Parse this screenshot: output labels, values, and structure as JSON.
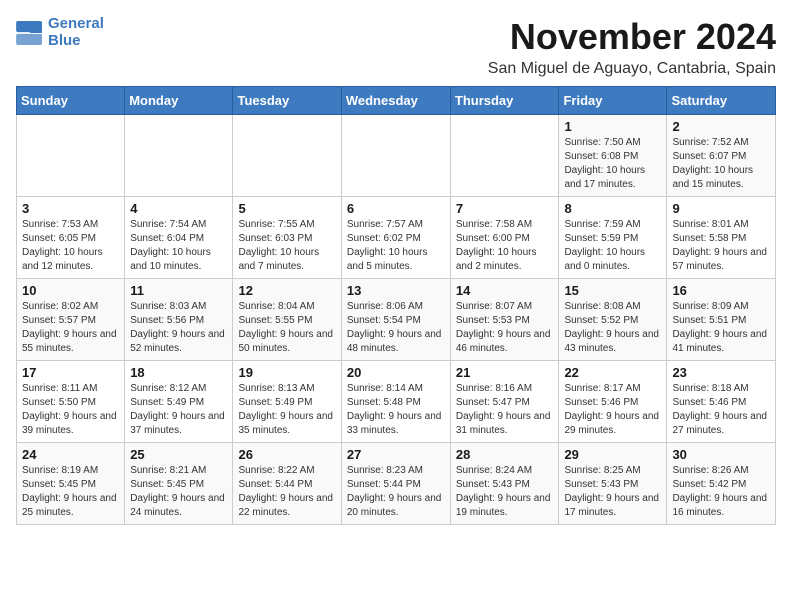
{
  "logo": {
    "line1": "General",
    "line2": "Blue"
  },
  "title": "November 2024",
  "location": "San Miguel de Aguayo, Cantabria, Spain",
  "headers": [
    "Sunday",
    "Monday",
    "Tuesday",
    "Wednesday",
    "Thursday",
    "Friday",
    "Saturday"
  ],
  "weeks": [
    [
      {
        "day": "",
        "info": ""
      },
      {
        "day": "",
        "info": ""
      },
      {
        "day": "",
        "info": ""
      },
      {
        "day": "",
        "info": ""
      },
      {
        "day": "",
        "info": ""
      },
      {
        "day": "1",
        "info": "Sunrise: 7:50 AM\nSunset: 6:08 PM\nDaylight: 10 hours and 17 minutes."
      },
      {
        "day": "2",
        "info": "Sunrise: 7:52 AM\nSunset: 6:07 PM\nDaylight: 10 hours and 15 minutes."
      }
    ],
    [
      {
        "day": "3",
        "info": "Sunrise: 7:53 AM\nSunset: 6:05 PM\nDaylight: 10 hours and 12 minutes."
      },
      {
        "day": "4",
        "info": "Sunrise: 7:54 AM\nSunset: 6:04 PM\nDaylight: 10 hours and 10 minutes."
      },
      {
        "day": "5",
        "info": "Sunrise: 7:55 AM\nSunset: 6:03 PM\nDaylight: 10 hours and 7 minutes."
      },
      {
        "day": "6",
        "info": "Sunrise: 7:57 AM\nSunset: 6:02 PM\nDaylight: 10 hours and 5 minutes."
      },
      {
        "day": "7",
        "info": "Sunrise: 7:58 AM\nSunset: 6:00 PM\nDaylight: 10 hours and 2 minutes."
      },
      {
        "day": "8",
        "info": "Sunrise: 7:59 AM\nSunset: 5:59 PM\nDaylight: 10 hours and 0 minutes."
      },
      {
        "day": "9",
        "info": "Sunrise: 8:01 AM\nSunset: 5:58 PM\nDaylight: 9 hours and 57 minutes."
      }
    ],
    [
      {
        "day": "10",
        "info": "Sunrise: 8:02 AM\nSunset: 5:57 PM\nDaylight: 9 hours and 55 minutes."
      },
      {
        "day": "11",
        "info": "Sunrise: 8:03 AM\nSunset: 5:56 PM\nDaylight: 9 hours and 52 minutes."
      },
      {
        "day": "12",
        "info": "Sunrise: 8:04 AM\nSunset: 5:55 PM\nDaylight: 9 hours and 50 minutes."
      },
      {
        "day": "13",
        "info": "Sunrise: 8:06 AM\nSunset: 5:54 PM\nDaylight: 9 hours and 48 minutes."
      },
      {
        "day": "14",
        "info": "Sunrise: 8:07 AM\nSunset: 5:53 PM\nDaylight: 9 hours and 46 minutes."
      },
      {
        "day": "15",
        "info": "Sunrise: 8:08 AM\nSunset: 5:52 PM\nDaylight: 9 hours and 43 minutes."
      },
      {
        "day": "16",
        "info": "Sunrise: 8:09 AM\nSunset: 5:51 PM\nDaylight: 9 hours and 41 minutes."
      }
    ],
    [
      {
        "day": "17",
        "info": "Sunrise: 8:11 AM\nSunset: 5:50 PM\nDaylight: 9 hours and 39 minutes."
      },
      {
        "day": "18",
        "info": "Sunrise: 8:12 AM\nSunset: 5:49 PM\nDaylight: 9 hours and 37 minutes."
      },
      {
        "day": "19",
        "info": "Sunrise: 8:13 AM\nSunset: 5:49 PM\nDaylight: 9 hours and 35 minutes."
      },
      {
        "day": "20",
        "info": "Sunrise: 8:14 AM\nSunset: 5:48 PM\nDaylight: 9 hours and 33 minutes."
      },
      {
        "day": "21",
        "info": "Sunrise: 8:16 AM\nSunset: 5:47 PM\nDaylight: 9 hours and 31 minutes."
      },
      {
        "day": "22",
        "info": "Sunrise: 8:17 AM\nSunset: 5:46 PM\nDaylight: 9 hours and 29 minutes."
      },
      {
        "day": "23",
        "info": "Sunrise: 8:18 AM\nSunset: 5:46 PM\nDaylight: 9 hours and 27 minutes."
      }
    ],
    [
      {
        "day": "24",
        "info": "Sunrise: 8:19 AM\nSunset: 5:45 PM\nDaylight: 9 hours and 25 minutes."
      },
      {
        "day": "25",
        "info": "Sunrise: 8:21 AM\nSunset: 5:45 PM\nDaylight: 9 hours and 24 minutes."
      },
      {
        "day": "26",
        "info": "Sunrise: 8:22 AM\nSunset: 5:44 PM\nDaylight: 9 hours and 22 minutes."
      },
      {
        "day": "27",
        "info": "Sunrise: 8:23 AM\nSunset: 5:44 PM\nDaylight: 9 hours and 20 minutes."
      },
      {
        "day": "28",
        "info": "Sunrise: 8:24 AM\nSunset: 5:43 PM\nDaylight: 9 hours and 19 minutes."
      },
      {
        "day": "29",
        "info": "Sunrise: 8:25 AM\nSunset: 5:43 PM\nDaylight: 9 hours and 17 minutes."
      },
      {
        "day": "30",
        "info": "Sunrise: 8:26 AM\nSunset: 5:42 PM\nDaylight: 9 hours and 16 minutes."
      }
    ]
  ]
}
